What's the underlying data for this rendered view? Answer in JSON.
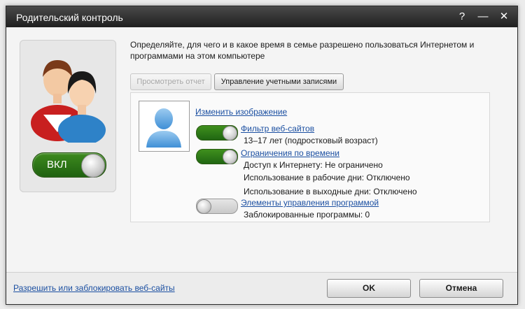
{
  "window": {
    "title": "Родительский контроль",
    "help_icon": "?",
    "minimize_icon": "—",
    "close_icon": "✕"
  },
  "status_toggle": {
    "label": "ВКЛ",
    "state": "on"
  },
  "description": "Определяйте, для чего и в какое время в семье разрешено пользоваться Интернетом и программами на этом компьютере",
  "buttons": {
    "view_report": "Просмотреть отчет",
    "manage_accounts": "Управление учетными записями"
  },
  "profile": {
    "change_image": "Изменить изображение"
  },
  "web_filter": {
    "label": "Фильтр веб-сайтов",
    "state": "on",
    "detail": "13–17 лет (подростковый возраст)"
  },
  "time_limits": {
    "label": "Ограничения по времени",
    "state": "on",
    "internet_access": "Доступ к Интернету: Не ограничено",
    "weekdays": "Использование в рабочие дни:  Отключено",
    "weekends": "Использование в выходные дни:  Отключено"
  },
  "program_controls": {
    "label": "Элементы управления программой",
    "state": "off",
    "blocked": "Заблокированные программы: 0"
  },
  "footer": {
    "link": "Разрешить или заблокировать веб-сайты",
    "ok": "OK",
    "cancel": "Отмена"
  },
  "colors": {
    "toggle_on": "#2d7a17",
    "link": "#1b4fa1",
    "titlebar": "#2a2a2a"
  }
}
